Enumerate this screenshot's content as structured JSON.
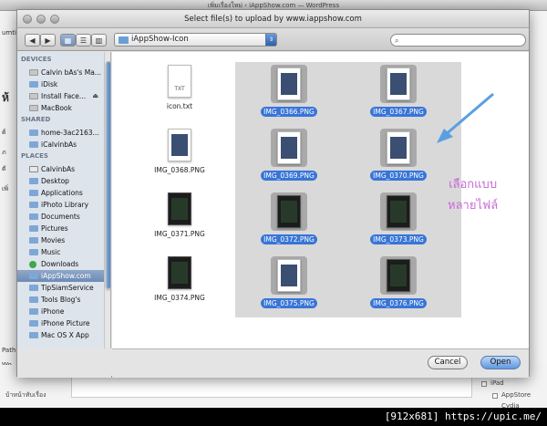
{
  "background": {
    "title": "เพิ่มเรื่องใหม่ ‹ iAppShow.com — WordPress",
    "left_fragments": [
      "umti",
      "ห้",
      "ต้",
      "ภ",
      "ตั",
      "เพิ่",
      "Path",
      "Wo"
    ],
    "bottom_left_text": "บ้าหน้าทับเรื่อง",
    "right_items": [
      "iPad",
      "AppStore",
      "Cydia"
    ]
  },
  "dialog": {
    "title": "Select file(s) to upload by www.iappshow.com",
    "toolbar": {
      "back": "◀",
      "forward": "▶",
      "view_icons": "▦",
      "view_list": "☰",
      "view_columns": "▥",
      "location": "iAppShow-Icon",
      "search_placeholder": ""
    },
    "sidebar": {
      "sections": [
        {
          "title": "DEVICES",
          "items": [
            {
              "label": "Calvin bAs's Ma...",
              "icon": "hard-drive-icon"
            },
            {
              "label": "iDisk",
              "icon": "idisk-icon"
            },
            {
              "label": "Install Face...",
              "icon": "disk-icon",
              "eject": "⏏"
            },
            {
              "label": "MacBook",
              "icon": "macbook-icon"
            }
          ]
        },
        {
          "title": "SHARED",
          "items": [
            {
              "label": "home-3ac2163...",
              "icon": "network-icon"
            },
            {
              "label": "iCalvinbAs",
              "icon": "computer-icon"
            }
          ]
        },
        {
          "title": "PLACES",
          "items": [
            {
              "label": "CalvinbAs",
              "icon": "home-icon"
            },
            {
              "label": "Desktop",
              "icon": "desktop-icon"
            },
            {
              "label": "Applications",
              "icon": "applications-icon"
            },
            {
              "label": "iPhoto Library",
              "icon": "iphoto-icon"
            },
            {
              "label": "Documents",
              "icon": "folder-icon"
            },
            {
              "label": "Pictures",
              "icon": "folder-icon"
            },
            {
              "label": "Movies",
              "icon": "folder-icon"
            },
            {
              "label": "Music",
              "icon": "folder-icon"
            },
            {
              "label": "Downloads",
              "icon": "downloads-icon"
            },
            {
              "label": "iAppShow.com",
              "icon": "folder-icon",
              "selected": true
            },
            {
              "label": "TipSiamService",
              "icon": "folder-icon"
            },
            {
              "label": "Tools Blog's",
              "icon": "folder-icon"
            },
            {
              "label": "iPhone",
              "icon": "folder-icon"
            },
            {
              "label": "iPhone Picture",
              "icon": "folder-icon"
            },
            {
              "label": "Mac OS X App",
              "icon": "folder-icon"
            }
          ]
        }
      ]
    },
    "files": [
      {
        "name": "icon.txt",
        "type": "txt",
        "badge": "TXT",
        "selected": false
      },
      {
        "name": "IMG_0366.PNG",
        "selected": true,
        "dark": false
      },
      {
        "name": "IMG_0367.PNG",
        "selected": true,
        "dark": false
      },
      {
        "name": "IMG_0368.PNG",
        "selected": false,
        "dark": false
      },
      {
        "name": "IMG_0369.PNG",
        "selected": true,
        "dark": false
      },
      {
        "name": "IMG_0370.PNG",
        "selected": true,
        "dark": false
      },
      {
        "name": "IMG_0371.PNG",
        "selected": false,
        "dark": true
      },
      {
        "name": "IMG_0372.PNG",
        "selected": true,
        "dark": true
      },
      {
        "name": "IMG_0373.PNG",
        "selected": true,
        "dark": true
      },
      {
        "name": "IMG_0374.PNG",
        "selected": false,
        "dark": true
      },
      {
        "name": "IMG_0375.PNG",
        "selected": true,
        "dark": false
      },
      {
        "name": "IMG_0376.PNG",
        "selected": true,
        "dark": true
      }
    ],
    "annotation": {
      "line1": "เลือกแบบ",
      "line2": "หลายไฟล์",
      "color": "#c86ad6",
      "arrow_color": "#5aa0e0"
    },
    "buttons": {
      "cancel": "Cancel",
      "open": "Open"
    }
  },
  "watermark": "[912x681] https://upic.me/"
}
